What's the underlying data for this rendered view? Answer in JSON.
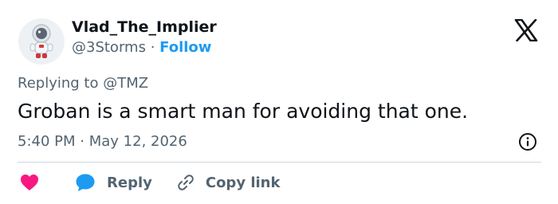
{
  "user": {
    "display_name": "Vlad_The_Implier",
    "handle": "@3Storms",
    "separator": "·",
    "follow_label": "Follow"
  },
  "tweet": {
    "replying_prefix": "Replying to",
    "replying_to": "@TMZ",
    "text": "Groban is a smart man for avoiding that one.",
    "time": "5:40 PM",
    "date_separator": "·",
    "date": "May 12, 2026"
  },
  "actions": {
    "reply_label": "Reply",
    "copy_link_label": "Copy link"
  },
  "icons": {
    "logo": "x-logo-icon",
    "info": "info-icon",
    "like": "heart-icon",
    "reply": "speech-bubble-icon",
    "copy": "link-icon"
  },
  "colors": {
    "accent": "#1d9bf0",
    "like": "#f91880",
    "text": "#0f1419",
    "secondary": "#536471",
    "divider": "#cfd9de"
  }
}
